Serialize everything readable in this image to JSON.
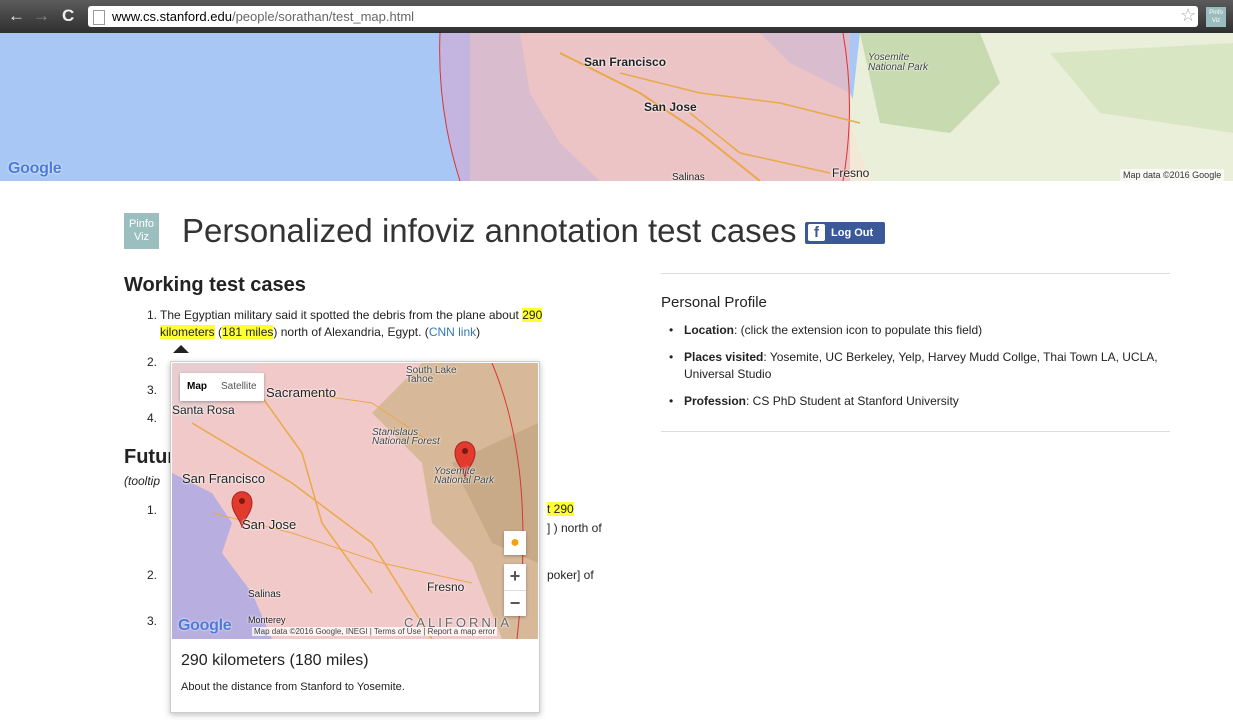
{
  "browser": {
    "url_domain": "www.cs.stanford.edu",
    "url_path": "/people/sorathan/test_map.html",
    "ext_label": "Pinfo Viz"
  },
  "top_map": {
    "labels": [
      "San Francisco",
      "San Jose",
      "Yosemite National Park",
      "Fresno",
      "Salinas"
    ],
    "google": "Google",
    "credit": "Map data ©2016 Google"
  },
  "header": {
    "logo": "Pinfo Viz",
    "title": "Personalized infoviz annotation test cases",
    "fb_icon": "f",
    "fb_label": "Log Out"
  },
  "working": {
    "heading": "Working test cases",
    "item1": {
      "num": "1.",
      "pre": "The Egyptian military said it spotted the debris from the plane about",
      "hl1": "290",
      "hl1b": "kilometers",
      "mid": "(",
      "hl2": "181 miles",
      "post": ") north of Alexandria, Egypt. (",
      "link": "CNN link",
      "end": ")"
    },
    "nums": [
      "2.",
      "3.",
      "4."
    ]
  },
  "future": {
    "heading": "Future",
    "sub": "(tooltip",
    "nums": [
      "1.",
      "2.",
      "3."
    ],
    "frag1a": "t 290",
    "frag1b": "] ) north of",
    "frag2": "poker] of"
  },
  "profile": {
    "title": "Personal Profile",
    "items": [
      {
        "label": "Location",
        "value": ": (click the extension icon to populate this field)"
      },
      {
        "label": "Places visited",
        "value": ": Yosemite, UC Berkeley, Yelp, Harvey Mudd Collge, Thai Town LA, UCLA, Universal Studio"
      },
      {
        "label": "Profession",
        "value": ": CS PhD Student at Stanford University"
      }
    ]
  },
  "popup": {
    "map_type": [
      "Map",
      "Satellite"
    ],
    "labels": [
      "Sacramento",
      "Santa Rosa",
      "South Lake Tahoe",
      "Stanislaus National Forest",
      "San Francisco",
      "Yosemite National Park",
      "San Jose",
      "Fresno",
      "Salinas",
      "Monterey",
      "CALIFORNIA"
    ],
    "zoom_in": "+",
    "zoom_out": "−",
    "google": "Google",
    "credit": "Map data ©2016 Google, INEGI",
    "terms": "Terms of Use",
    "report": "Report a map error",
    "title": "290 kilometers (180 miles)",
    "desc": "About the distance from Stanford to Yosemite."
  }
}
